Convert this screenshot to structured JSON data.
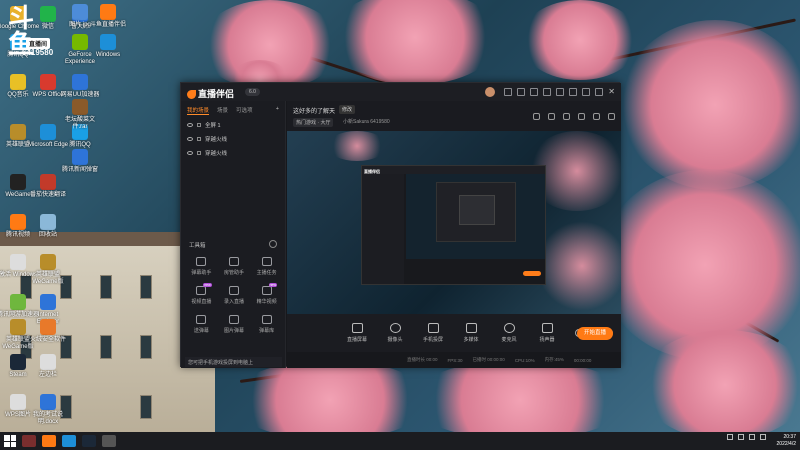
{
  "logo": {
    "text": "斗鱼",
    "badge": "直播间",
    "room_no": "6419580"
  },
  "desktop_icons": [
    {
      "label": "Google Chrome",
      "color": "#e8b12c"
    },
    {
      "label": "微信",
      "color": "#21b34a"
    },
    {
      "label": "鲁大师",
      "color": "#2e74d8"
    },
    {
      "label": "QQ音乐",
      "color": "#e8c026"
    },
    {
      "label": "WPS Office",
      "color": "#d83a2e"
    },
    {
      "label": "网易UU加速器",
      "color": "#2e74d8"
    },
    {
      "label": "英雄联盟",
      "color": "#b88d2a"
    },
    {
      "label": "Microsoft Edge",
      "color": "#1d8fd8"
    },
    {
      "label": "腾讯QQ",
      "color": "#1aa0e6"
    },
    {
      "label": "WeGame",
      "color": "#222"
    },
    {
      "label": "番茄快速翻译",
      "color": "#c23a2a"
    },
    {
      "label": "腾讯视频",
      "color": "#ff7a14"
    },
    {
      "label": "回收站",
      "color": "#8bb8d8"
    },
    {
      "label": "激活 Windows",
      "color": "#dddddd"
    },
    {
      "label": "英雄联盟 WeGame版",
      "color": "#b88d2a"
    },
    {
      "label": "腾讯网游加速器",
      "color": "#6fb73e"
    },
    {
      "label": "Internet Explorer",
      "color": "#2e74d8"
    },
    {
      "label": "英雄联盟 WeGame版",
      "color": "#b88d2a"
    },
    {
      "label": "火绒安全软件",
      "color": "#e8792a"
    },
    {
      "label": "Steam",
      "color": "#1b2838"
    },
    {
      "label": "左边栏",
      "color": "#dddddd"
    },
    {
      "label": "WPS图片",
      "color": "#dddddd"
    },
    {
      "label": "我的考试说明.docx",
      "color": "#2e74d8"
    },
    {
      "label": "图片.jpg",
      "color": "#4d8cd8"
    },
    {
      "label": "GeForce Experience",
      "color": "#76b900"
    },
    {
      "label": "老坛酸菜文件.rar",
      "color": "#8a5a2a"
    },
    {
      "label": "腾讯新闻弹窗",
      "color": "#2e74d8"
    },
    {
      "label": "斗鱼直播伴侣",
      "color": "#ff7a14"
    },
    {
      "label": "Windows",
      "color": "#1d8fd8"
    },
    {
      "label": "腾讯QQ",
      "color": "#1aa0e6"
    }
  ],
  "app": {
    "brand": "直播伴侣",
    "version": "6.0",
    "sidebar": {
      "tabs": [
        "我的场景",
        "场景",
        "可选项",
        "+"
      ],
      "scenes": [
        "全屏 1",
        "穿越火线",
        "穿越火线"
      ],
      "tools_title": "工具箱",
      "tools": [
        {
          "label": "弹幕助手",
          "new": false
        },
        {
          "label": "房管助手",
          "new": false
        },
        {
          "label": "主播任务",
          "new": false
        },
        {
          "label": "视频直播",
          "new": true
        },
        {
          "label": "录入直播",
          "new": false
        },
        {
          "label": "精华视频",
          "new": true
        },
        {
          "label": "送弹幕",
          "new": false
        },
        {
          "label": "图片弹幕",
          "new": false
        },
        {
          "label": "弹幕库",
          "new": false
        }
      ],
      "promo": "您可把手机游戏投屏到电脑上"
    },
    "room": {
      "title": "这好多的了解天",
      "tag": "修改",
      "category": "热门游戏 · 大厅",
      "streamer": "小新Sakura  6419580"
    },
    "controls": [
      {
        "label": "直播屏幕"
      },
      {
        "label": "摄像头"
      },
      {
        "label": "手机投屏"
      },
      {
        "label": "多媒体"
      },
      {
        "label": "麦克风"
      },
      {
        "label": "扬声器"
      }
    ],
    "go_live": "开始直播",
    "status": [
      "直播时长 00:00",
      "FPS:30",
      "已播时 00:00:00",
      "CPU:10%",
      "内存:45%",
      "00:00:00"
    ]
  },
  "taskbar": {
    "time": "20:37",
    "date": "2022/4/2"
  }
}
